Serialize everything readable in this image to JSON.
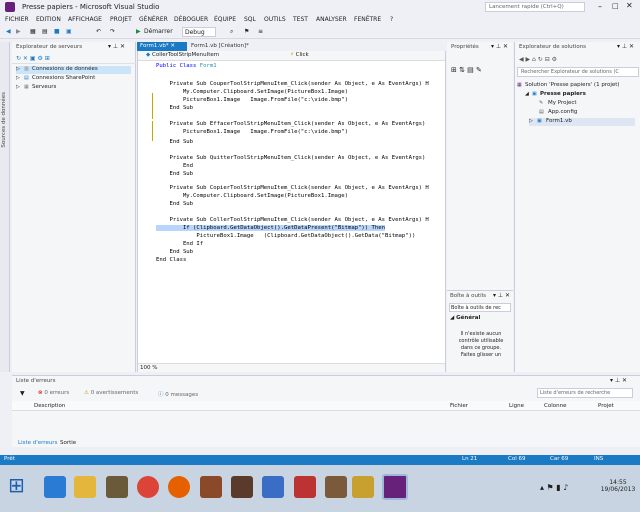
{
  "window": {
    "title": "Presse papiers - Microsoft Visual Studio",
    "quick_launch": "Lancement rapide (Ctrl+Q)"
  },
  "menu": [
    "FICHIER",
    "EDITION",
    "AFFICHAGE",
    "PROJET",
    "GÉNÉRER",
    "DÉBOGUER",
    "ÉQUIPE",
    "SQL",
    "OUTILS",
    "TEST",
    "ANALYSER",
    "FENÊTRE",
    "?"
  ],
  "toolbar": {
    "start_label": "Démarrer",
    "config": "Debug"
  },
  "left_strip": "Sources de données",
  "server_explorer": {
    "title": "Explorateur de serveurs",
    "items": [
      "Connexions de données",
      "Connexions SharePoint",
      "Serveurs"
    ]
  },
  "tabs": {
    "tab1": "Form1.vb*",
    "tab2": "Form1.vb [Création]*"
  },
  "editor": {
    "dropdown_left": "CollerToolStripMenuItem",
    "dropdown_right": "Click",
    "zoom": "100 %",
    "code": {
      "l1": "Public Class Form1",
      "l2": "    Private Sub CouperToolStripMenuItem_Click(sender As Object, e As EventArgs) H",
      "l3": "        My.Computer.Clipboard.SetImage(PictureBox1.Image)",
      "l4": "        PictureBox1.Image   Image.FromFile(\"c:\\vide.bmp\")",
      "l5": "    End Sub",
      "l6": "    Private Sub EffacerToolStripMenuItem_Click(sender As Object, e As EventArgs)",
      "l7": "        PictureBox1.Image   Image.FromFile(\"c:\\vide.bmp\")",
      "l8": "    End Sub",
      "l9": "    Private Sub QuitterToolStripMenuItem_Click(sender As Object, e As EventArgs)",
      "l10": "        End",
      "l11": "    End Sub",
      "l12": "    Private Sub CopierToolStripMenuItem_Click(sender As Object, e As EventArgs) H",
      "l13": "        My.Computer.Clipboard.SetImage(PictureBox1.Image)",
      "l14": "    End Sub",
      "l15": "    Private Sub CollerToolStripMenuItem_Click(sender As Object, e As EventArgs) H",
      "l16": "        If (Clipboard.GetDataObject().GetDataPresent(\"Bitmap\")) Then",
      "l17": "            PictureBox1.Image   (Clipboard.GetDataObject().GetData(\"Bitmap\"))",
      "l18": "        End If",
      "l19": "    End Sub",
      "l20": "End Class"
    }
  },
  "properties": {
    "title": "Propriétés"
  },
  "toolbox": {
    "title": "Boîte à outils",
    "search": "Boîte à outils de rec",
    "group": "Général",
    "empty_msg": "Il n'existe aucun contrôle utilisable dans ce groupe. Faites glisser un"
  },
  "solution": {
    "title": "Explorateur de solutions",
    "search": "Rechercher Explorateur de solutions (C",
    "items": [
      "Solution 'Presse papiers' (1 projet)",
      "Presse papiers",
      "My Project",
      "App.config",
      "Form1.vb"
    ]
  },
  "errorlist": {
    "title": "Liste d'erreurs",
    "errors": "0 erreurs",
    "warnings": "0 avertissements",
    "messages": "0 messages",
    "search": "Liste d'erreurs de recherche",
    "cols": [
      "Description",
      "Fichier",
      "Ligne",
      "Colonne",
      "Projet"
    ],
    "tabs": [
      "Liste d'erreurs",
      "Sortie"
    ]
  },
  "status": {
    "ready": "Prêt",
    "ln": "Ln 21",
    "col": "Col 69",
    "car": "Car 69",
    "ins": "INS"
  },
  "clock": {
    "time": "14:55",
    "date": "19/06/2013"
  }
}
